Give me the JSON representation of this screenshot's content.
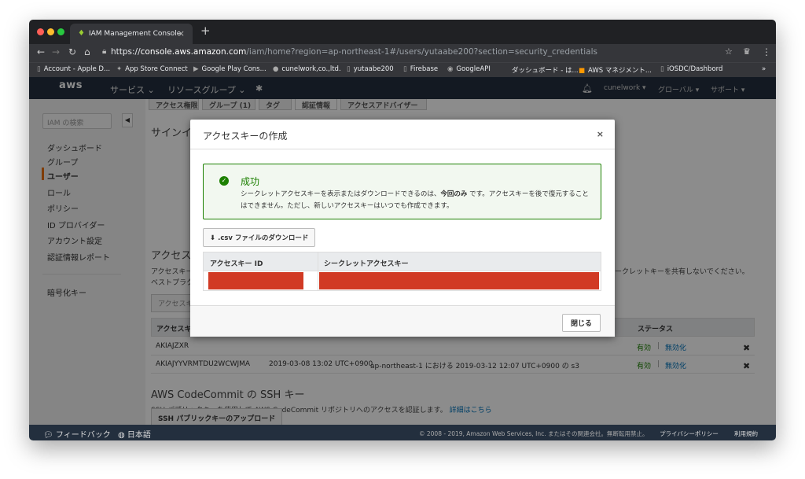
{
  "browser": {
    "tab_title": "IAM Management Console",
    "new_tab": "+",
    "url_prefix": "https://",
    "url_host": "console.aws.amazon.com",
    "url_path": "/iam/home?region=ap-northeast-1#/users/yutaabe200?section=security_credentials",
    "bookmarks": [
      "Account - Apple D...",
      "App Store Connect",
      "Google Play Cons...",
      "cunelwork,co.,ltd.",
      "yutaabe200",
      "Firebase",
      "GoogleAPI",
      "ダッシュボード - は...",
      "AWS マネジメント...",
      "iOSDC/Dashbord"
    ],
    "more": "»"
  },
  "aws_nav": {
    "logo": "aws",
    "services": "サービス ⌄",
    "resource_groups": "リソースグループ ⌄",
    "account": "cunelwork ▾",
    "region": "グローバル ▾",
    "support": "サポート ▾"
  },
  "sidebar": {
    "search_placeholder": "IAM の検索",
    "items": [
      "ダッシュボード",
      "グループ",
      "ユーザー",
      "ロール",
      "ポリシー",
      "ID プロバイダー",
      "アカウント設定",
      "認証情報レポート"
    ],
    "encryption": "暗号化キー"
  },
  "main": {
    "tabs": [
      "アクセス権限",
      "グループ (1)",
      "タグ",
      "認証情報",
      "アクセスアドバイザー"
    ],
    "signin_heading": "サインイ",
    "access_heading": "アクセス",
    "access_para_1": "アクセスキー",
    "access_para_2": "ベストプラク",
    "access_para_right": "ークレットキーを共有しないでください。",
    "create_key_btn": "アクセスキ",
    "table_headers": {
      "key_id": "アクセスキ",
      "status": "ステータス"
    },
    "rows": [
      {
        "key_id": "AKIAJZXR",
        "status": "有効",
        "action": "無効化"
      },
      {
        "key_id": "AKIAJYYVRMTDU2WCWJMA",
        "last_used": "2019-03-08 13:02 UTC+0900",
        "region_info": "ap-northeast-1 における 2019-03-12 12:07 UTC+0900 の s3",
        "status": "有効",
        "action": "無効化"
      }
    ],
    "codecommit_heading": "AWS CodeCommit の SSH キー",
    "codecommit_text": "SSH パブリックキーを使用して AWS CodeCommit リポジトリへのアクセスを認証します。",
    "codecommit_link": "詳細はこちら",
    "ssh_upload_btn": "SSH パブリックキーのアップロード"
  },
  "modal": {
    "title": "アクセスキーの作成",
    "close_x": "×",
    "success_title": "成功",
    "success_msg_1": "シークレットアクセスキーを表示またはダウンロードできるのは、",
    "success_msg_bold": "今回のみ",
    "success_msg_2": " です。アクセスキーを後で復元することはできません。ただし、新しいアクセスキーはいつでも作成できます。",
    "download_btn": ".csv ファイルのダウンロード",
    "col_key_id": "アクセスキー ID",
    "col_secret": "シークレットアクセスキー",
    "close_btn": "閉じる"
  },
  "footer": {
    "feedback": "フィードバック",
    "language": "日本語",
    "copyright": "© 2008 - 2019, Amazon Web Services, Inc. またはその関連会社。無断転用禁止。",
    "privacy": "プライバシーポリシー",
    "terms": "利用規約"
  },
  "colors": {
    "aws_nav": "#232f3e",
    "success": "#1d8102",
    "redaction": "#d13a24",
    "link": "#0073bb"
  }
}
